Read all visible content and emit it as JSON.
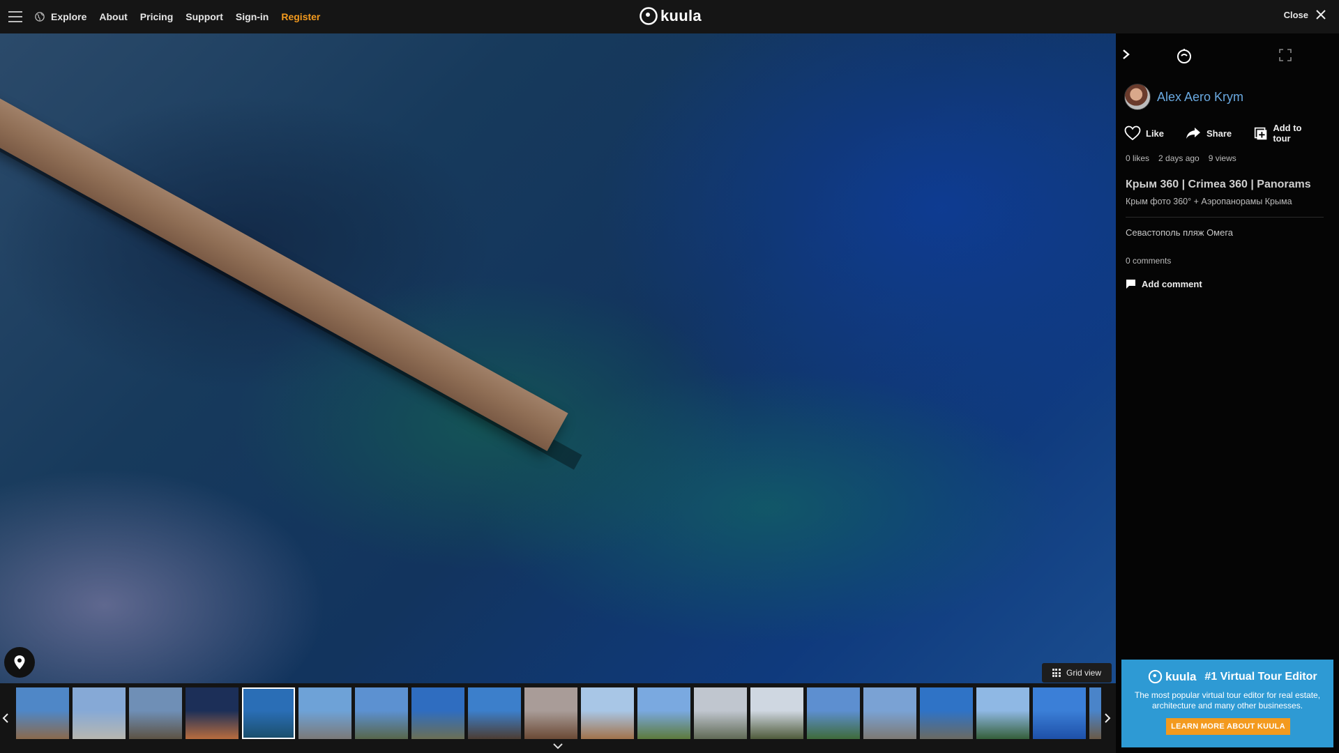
{
  "nav": {
    "menu_icon": "hamburger-icon",
    "globe_icon": "globe-icon",
    "explore": "Explore",
    "about": "About",
    "pricing": "Pricing",
    "support": "Support",
    "signin": "Sign-in",
    "register": "Register",
    "register_color": "#f39a1e"
  },
  "logo": {
    "text": "kuula"
  },
  "close": {
    "label": "Close"
  },
  "viewer": {
    "grid_view_label": "Grid view"
  },
  "sidebar": {
    "author_name": "Alex Aero Krym",
    "actions": {
      "like": "Like",
      "share": "Share",
      "add_to_tour": "Add to tour"
    },
    "stats": {
      "likes": "0 likes",
      "posted": "2 days ago",
      "views": "9 views"
    },
    "album_title": "Крым 360 | Crimea 360 | Panorams",
    "album_subtitle": "Крым фото 360° + Аэропанорамы Крыма",
    "description": "Севастополь пляж Омега",
    "comments_count": "0 comments",
    "add_comment": "Add comment",
    "author_color": "#6aa9e0"
  },
  "promo": {
    "logo_text": "kuula",
    "title": "#1 Virtual Tour Editor",
    "text": "The most popular virtual tour editor for real estate, architecture and many other businesses.",
    "button": "LEARN MORE ABOUT KUULA",
    "background": "#2e9ad4"
  },
  "filmstrip": {
    "active_index": 4,
    "thumbnails": [
      {
        "top": "#4f87c7",
        "bottom": "#8a6a4c"
      },
      {
        "top": "#86a9d6",
        "bottom": "#b7b7b0"
      },
      {
        "top": "#6f8fb6",
        "bottom": "#5d5344"
      },
      {
        "top": "#1c2f58",
        "bottom": "#b86c3e"
      },
      {
        "top": "#2a6eb6",
        "bottom": "#1b4e6a"
      },
      {
        "top": "#6ea2d7",
        "bottom": "#7b7a78"
      },
      {
        "top": "#5c91d1",
        "bottom": "#58664b"
      },
      {
        "top": "#2f6dc0",
        "bottom": "#6b6f55"
      },
      {
        "top": "#3c7fcb",
        "bottom": "#4c3d33"
      },
      {
        "top": "#a99c98",
        "bottom": "#6b4a35"
      },
      {
        "top": "#a8c6e6",
        "bottom": "#a2734b"
      },
      {
        "top": "#7aa9e0",
        "bottom": "#5d7a3c"
      },
      {
        "top": "#c0c6cf",
        "bottom": "#606a55"
      },
      {
        "top": "#cfd7e1",
        "bottom": "#4f5b3b"
      },
      {
        "top": "#5d8fd0",
        "bottom": "#3f6b3a"
      },
      {
        "top": "#7aa2d4",
        "bottom": "#7d7a74"
      },
      {
        "top": "#2f73c6",
        "bottom": "#6a6a62"
      },
      {
        "top": "#8fb8e4",
        "bottom": "#355f3a"
      },
      {
        "top": "#3b7fd7",
        "bottom": "#1e50a8"
      },
      {
        "top": "#4a84c9",
        "bottom": "#6a5a47"
      }
    ]
  }
}
